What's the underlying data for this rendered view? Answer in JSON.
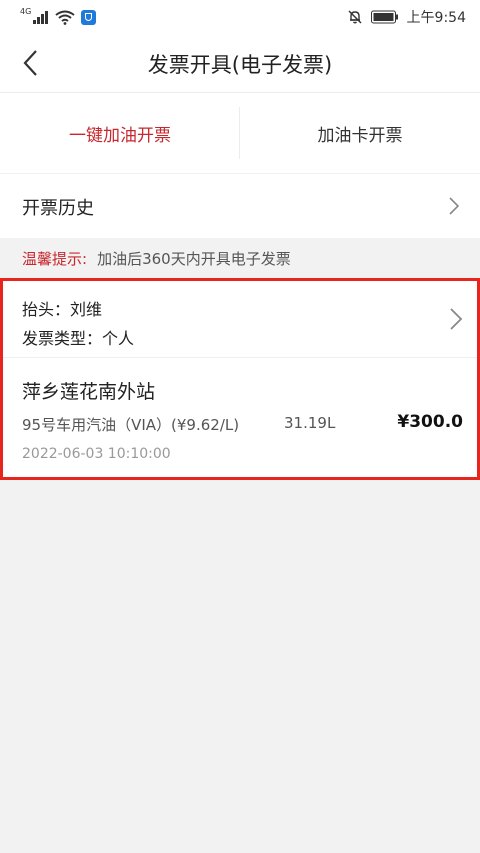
{
  "status_bar": {
    "network": "4G",
    "time": "上午9:54"
  },
  "header": {
    "title": "发票开具(电子发票)"
  },
  "tabs": [
    {
      "label": "一键加油开票",
      "active": true
    },
    {
      "label": "加油卡开票",
      "active": false
    }
  ],
  "history": {
    "label": "开票历史"
  },
  "tip": {
    "label": "温馨提示:",
    "text": "加油后360天内开具电子发票"
  },
  "invoice": {
    "title_line": "抬头：刘维",
    "type_line": "发票类型：个人",
    "station": "萍乡莲花南外站",
    "fuel": "95号车用汽油（VIA）(¥9.62/L)",
    "volume": "31.19L",
    "amount": "¥300.0",
    "datetime": "2022-06-03 10:10:00"
  },
  "colors": {
    "accent": "#c8272d",
    "highlight_border": "#e8241e",
    "background": "#f2f2f2"
  }
}
